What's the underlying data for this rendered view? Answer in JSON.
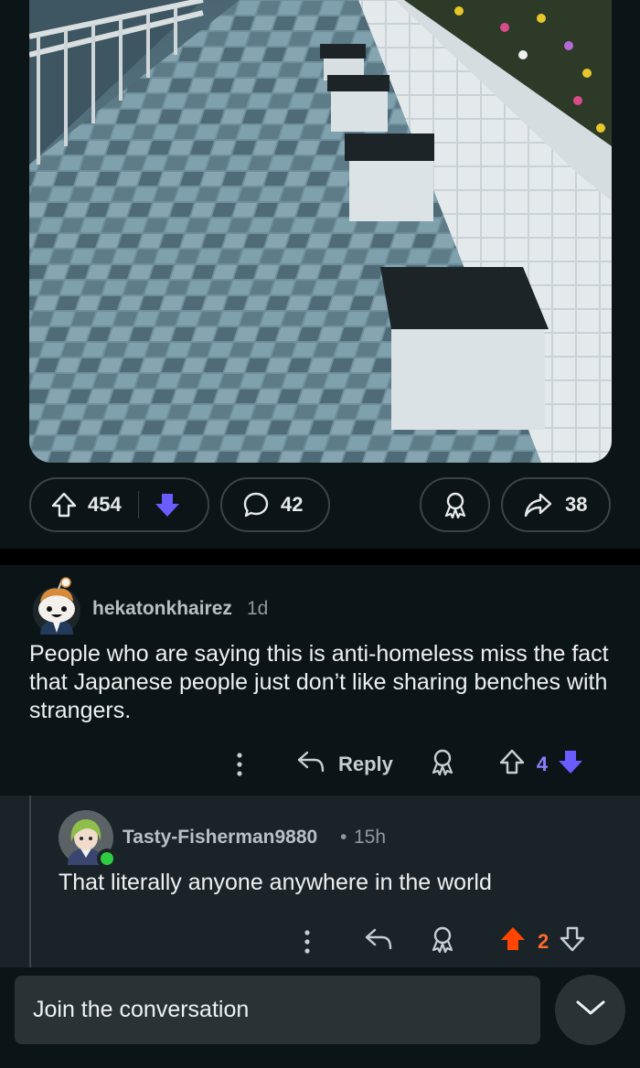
{
  "post": {
    "image_alt": "Tiled promenade with square benches along a planter wall",
    "upvotes": "454",
    "comments": "42",
    "shares": "38",
    "vote_state": "downvoted"
  },
  "comment": {
    "username": "hekatonkhairez",
    "age": "1d",
    "body": "People who are saying this is anti-homeless miss the fact that Japanese people just don’t like sharing benches with strangers.",
    "reply_label": "Reply",
    "score": "4",
    "vote_state": "downvoted"
  },
  "reply": {
    "username": "Tasty-Fisherman9880",
    "separator": "•",
    "age": "15h",
    "body": "That literally anyone anywhere in the world",
    "score": "2",
    "vote_state": "upvoted",
    "online": true
  },
  "composer": {
    "placeholder": "Join the conversation"
  },
  "colors": {
    "background": "#0b1416",
    "reply_background": "#1a2428",
    "downvote": "#6a5cff",
    "upvote": "#ff4500",
    "online": "#2ecc40"
  }
}
